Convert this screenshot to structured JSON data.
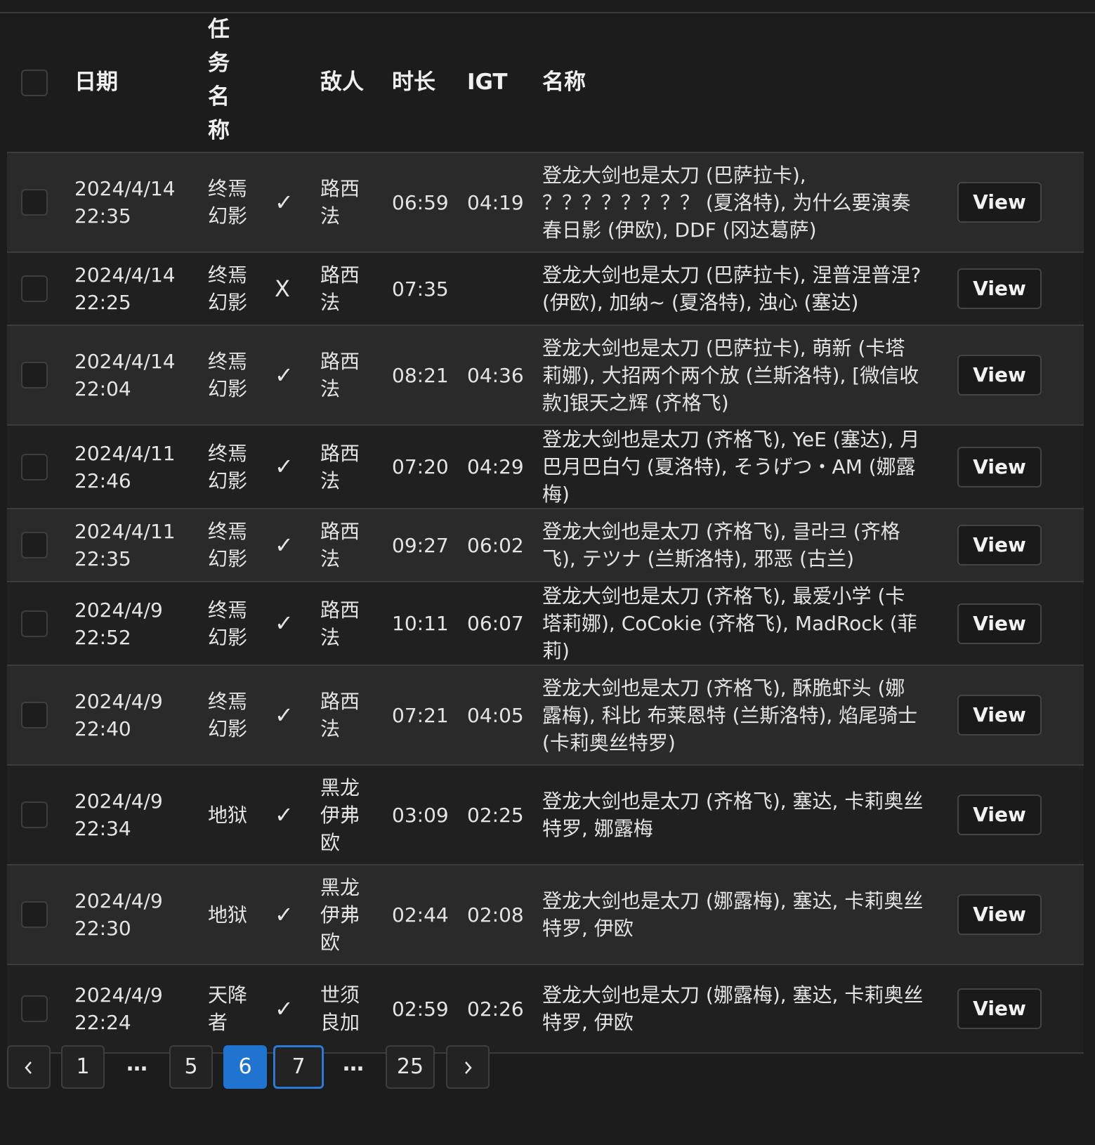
{
  "headers": {
    "date": "日期",
    "task": "任务名称",
    "enemy": "敌人",
    "duration": "时长",
    "igt": "IGT",
    "names": "名称"
  },
  "rows": [
    {
      "date": "2024/4/14",
      "time": "22:35",
      "task": "终焉幻影",
      "result": "✓",
      "enemy": "路西法",
      "duration": "06:59",
      "igt": "04:19",
      "names": "登龙大剑也是太刀 (巴萨拉卡), ？？？？？？？？ (夏洛特), 为什么要演奏春日影 (伊欧), DDF (冈达葛萨)",
      "view": "View"
    },
    {
      "date": "2024/4/14",
      "time": "22:25",
      "task": "终焉幻影",
      "result": "X",
      "enemy": "路西法",
      "duration": "07:35",
      "igt": "",
      "names": "登龙大剑也是太刀 (巴萨拉卡), 涅普涅普涅? (伊欧), 加纳~ (夏洛特), 浊心 (塞达)",
      "view": "View"
    },
    {
      "date": "2024/4/14",
      "time": "22:04",
      "task": "终焉幻影",
      "result": "✓",
      "enemy": "路西法",
      "duration": "08:21",
      "igt": "04:36",
      "names": "登龙大剑也是太刀 (巴萨拉卡), 萌新 (卡塔莉娜), 大招两个两个放 (兰斯洛特), [微信收款]银天之辉 (齐格飞)",
      "view": "View"
    },
    {
      "date": "2024/4/11",
      "time": "22:46",
      "task": "终焉幻影",
      "result": "✓",
      "enemy": "路西法",
      "duration": "07:20",
      "igt": "04:29",
      "names": "登龙大剑也是太刀 (齐格飞), YeE (塞达), 月巴月巴白勺 (夏洛特), そうげつ・AM (娜露梅)",
      "view": "View"
    },
    {
      "date": "2024/4/11",
      "time": "22:35",
      "task": "终焉幻影",
      "result": "✓",
      "enemy": "路西法",
      "duration": "09:27",
      "igt": "06:02",
      "names": "登龙大剑也是太刀 (齐格飞), 클라크 (齐格飞), テツナ (兰斯洛特), 邪恶 (古兰)",
      "view": "View"
    },
    {
      "date": "2024/4/9",
      "time": "22:52",
      "task": "终焉幻影",
      "result": "✓",
      "enemy": "路西法",
      "duration": "10:11",
      "igt": "06:07",
      "names": "登龙大剑也是太刀 (齐格飞), 最爱小学 (卡塔莉娜), CoCokie (齐格飞), MadRock (菲莉)",
      "view": "View"
    },
    {
      "date": "2024/4/9",
      "time": "22:40",
      "task": "终焉幻影",
      "result": "✓",
      "enemy": "路西法",
      "duration": "07:21",
      "igt": "04:05",
      "names": "登龙大剑也是太刀 (齐格飞), 酥脆虾头 (娜露梅), 科比 布莱恩特 (兰斯洛特), 焰尾骑士 (卡莉奥丝特罗)",
      "view": "View"
    },
    {
      "date": "2024/4/9",
      "time": "22:34",
      "task": "地狱",
      "result": "✓",
      "enemy": "黑龙伊弗欧",
      "duration": "03:09",
      "igt": "02:25",
      "names": "登龙大剑也是太刀 (齐格飞), 塞达, 卡莉奥丝特罗, 娜露梅",
      "view": "View"
    },
    {
      "date": "2024/4/9",
      "time": "22:30",
      "task": "地狱",
      "result": "✓",
      "enemy": "黑龙伊弗欧",
      "duration": "02:44",
      "igt": "02:08",
      "names": "登龙大剑也是太刀 (娜露梅), 塞达, 卡莉奥丝特罗, 伊欧",
      "view": "View"
    },
    {
      "date": "2024/4/9",
      "time": "22:24",
      "task": "天降者",
      "result": "✓",
      "enemy": "世须良加",
      "duration": "02:59",
      "igt": "02:26",
      "names": "登龙大剑也是太刀 (娜露梅), 塞达, 卡莉奥丝特罗, 伊欧",
      "view": "View"
    }
  ],
  "pagination": {
    "prev_icon": "chevron-left-icon",
    "next_icon": "chevron-right-icon",
    "pages": [
      "1",
      "…",
      "5",
      "6",
      "7",
      "…",
      "25"
    ],
    "current": "6"
  },
  "colors": {
    "accent": "#1f74d0",
    "bg": "#1c1c1c",
    "row_alt": "#2a2a2a"
  }
}
